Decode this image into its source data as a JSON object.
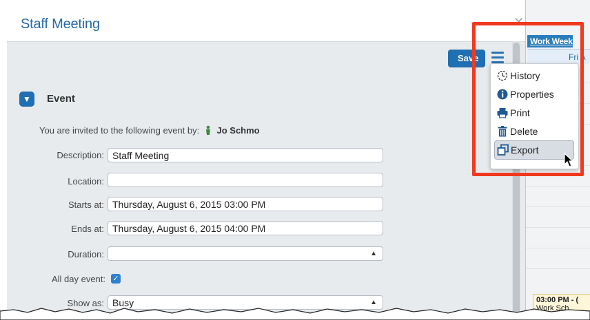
{
  "dialog": {
    "title": "Staff Meeting",
    "save_label": "Save",
    "section_title": "Event",
    "invite_text": "You are invited to the following event by:",
    "invite_user": "Jo Schmo",
    "fields": {
      "description": {
        "label": "Description:",
        "value": "Staff Meeting"
      },
      "location": {
        "label": "Location:",
        "value": ""
      },
      "starts_at": {
        "label": "Starts at:",
        "value": "Thursday, August 6, 2015 03:00 PM"
      },
      "ends_at": {
        "label": "Ends at:",
        "value": "Thursday, August 6, 2015 04:00 PM"
      },
      "duration": {
        "label": "Duration:",
        "value": ""
      },
      "all_day": {
        "label": "All day event:",
        "checked": true
      },
      "show_as": {
        "label": "Show as:",
        "value": "Busy"
      }
    }
  },
  "menu": {
    "items": [
      {
        "label": "History",
        "icon": "history-icon"
      },
      {
        "label": "Properties",
        "icon": "info-icon"
      },
      {
        "label": "Print",
        "icon": "printer-icon"
      },
      {
        "label": "Delete",
        "icon": "trash-icon"
      },
      {
        "label": "Export",
        "icon": "export-icon"
      }
    ]
  },
  "background": {
    "work_week_tab": "Work Week",
    "header_fragment": "Fri A",
    "event_time": "03:00 PM - (",
    "event_title": "Work Sch"
  },
  "colors": {
    "accent": "#1f6fb2",
    "highlight": "#f0391f",
    "title": "#2569a6"
  }
}
